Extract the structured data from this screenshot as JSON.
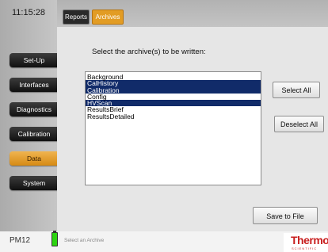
{
  "clock": "11:15:28",
  "tabs": [
    {
      "label": "Reports"
    },
    {
      "label": "Archives"
    }
  ],
  "sidebar": {
    "items": [
      {
        "label": "Set-Up"
      },
      {
        "label": "Interfaces"
      },
      {
        "label": "Diagnostics"
      },
      {
        "label": "Calibration"
      },
      {
        "label": "Data"
      },
      {
        "label": "System"
      }
    ]
  },
  "main": {
    "prompt": "Select the archive(s) to be written:",
    "archives": [
      {
        "label": "Background",
        "selected": false
      },
      {
        "label": "CalHistory",
        "selected": true
      },
      {
        "label": "Calibration",
        "selected": true
      },
      {
        "label": "Config",
        "selected": false
      },
      {
        "label": "HVScan",
        "selected": true
      },
      {
        "label": "ResultsBrief",
        "selected": false
      },
      {
        "label": "ResultsDetailed",
        "selected": false
      }
    ],
    "select_all": "Select All",
    "deselect_all": "Deselect All",
    "save_to_file": "Save to File"
  },
  "status": {
    "instrument": "PM12",
    "message": "Select an Archive",
    "logo": "Thermo",
    "logo_sub": "SCIENTIFIC"
  },
  "colors": {
    "selected_row": "#112b69",
    "active_orange": "#e29c24",
    "battery": "#2cd410",
    "brand_red": "#c81e1e"
  }
}
